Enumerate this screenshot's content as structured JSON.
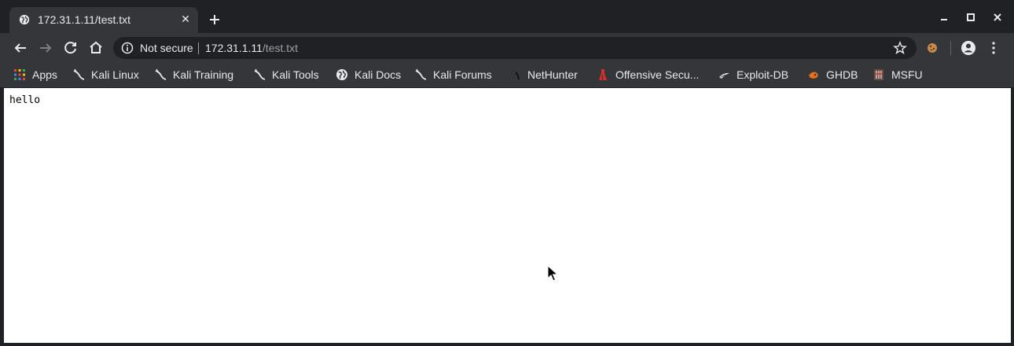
{
  "tab": {
    "title": "172.31.1.11/test.txt",
    "favicon": "globe-icon"
  },
  "toolbar": {
    "security_label": "Not secure",
    "url_host": "172.31.1.11",
    "url_path": "/test.txt"
  },
  "bookmarks": [
    {
      "label": "Apps",
      "icon": "apps-grid-icon"
    },
    {
      "label": "Kali Linux",
      "icon": "kali-dragon-icon"
    },
    {
      "label": "Kali Training",
      "icon": "kali-dragon-icon"
    },
    {
      "label": "Kali Tools",
      "icon": "kali-dragon-icon"
    },
    {
      "label": "Kali Docs",
      "icon": "globe-icon"
    },
    {
      "label": "Kali Forums",
      "icon": "kali-dragon-icon"
    },
    {
      "label": "NetHunter",
      "icon": "nethunter-icon"
    },
    {
      "label": "Offensive Secu...",
      "icon": "offsec-icon"
    },
    {
      "label": "Exploit-DB",
      "icon": "exploitdb-icon"
    },
    {
      "label": "GHDB",
      "icon": "ghdb-icon"
    },
    {
      "label": "MSFU",
      "icon": "msfu-icon"
    }
  ],
  "page": {
    "text": "hello"
  },
  "colors": {
    "chrome_dark": "#202124",
    "chrome_toolbar": "#35363a",
    "text_light": "#e8eaed",
    "text_dim": "#9aa0a6"
  }
}
